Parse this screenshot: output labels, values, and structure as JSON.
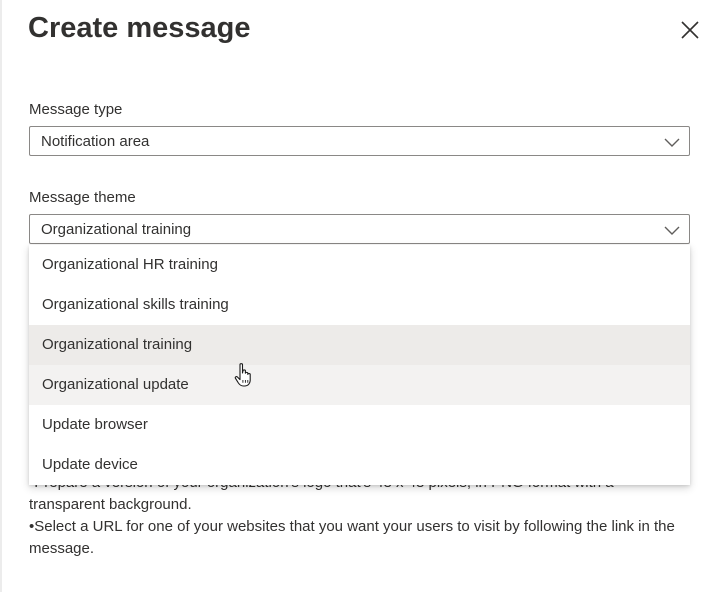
{
  "dialog": {
    "title": "Create message",
    "close_icon": "close-icon"
  },
  "message_type": {
    "label": "Message type",
    "value": "Notification area",
    "icon": "chevron-down-icon"
  },
  "message_theme": {
    "label": "Message theme",
    "value": "Organizational training",
    "icon": "chevron-down-icon",
    "options": [
      {
        "label": "Organizational HR training",
        "state": "normal"
      },
      {
        "label": "Organizational skills training",
        "state": "normal"
      },
      {
        "label": "Organizational training",
        "state": "selected"
      },
      {
        "label": "Organizational update",
        "state": "hovered"
      },
      {
        "label": "Update browser",
        "state": "normal"
      },
      {
        "label": "Update device",
        "state": "normal"
      }
    ]
  },
  "instructions": {
    "logo_line": "•Prepare a version of your organization's logo that's 48 x 48 pixels, in PNG format with a transparent background.",
    "url_line": "•Select a URL for one of your websites that you want your users to visit by following the link in the message."
  },
  "colors": {
    "border": "#8a8886",
    "selected_bg": "#edebe9",
    "hover_bg": "#f3f2f1",
    "text": "#323130"
  }
}
